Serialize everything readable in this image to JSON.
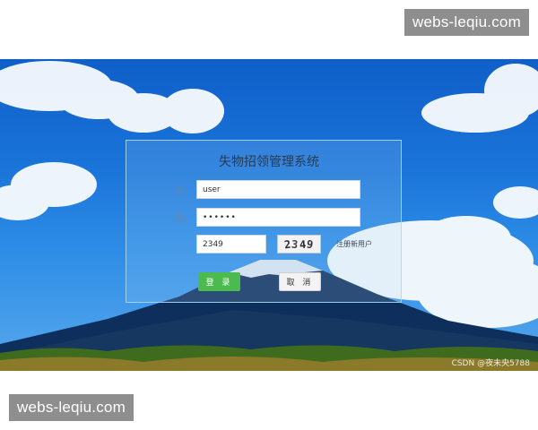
{
  "watermark_top": "webs-leqiu.com",
  "watermark_bottom": "webs-leqiu.com",
  "login": {
    "title": "失物招领管理系统",
    "username_value": "user",
    "password_value": "••••••",
    "captcha_input_value": "2349",
    "captcha_image_text": "2349",
    "register_link": "注册新用户",
    "login_button": "登 录",
    "cancel_button": "取 消"
  },
  "credit": "CSDN @夜未央5788",
  "icons": {
    "username": "user-icon",
    "password": "lock-icon"
  },
  "colors": {
    "login_button": "#4cbb4f",
    "sky": "#1a74d9",
    "panel_border": "#aad7fa"
  }
}
